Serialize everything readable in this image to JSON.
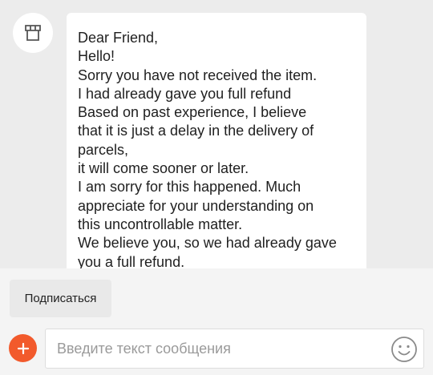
{
  "chat": {
    "avatar_icon": "store-icon",
    "message_lines": [
      "Dear Friend,",
      "Hello!",
      "Sorry you have not received the item.",
      "I had already gave you full refund",
      "Based on past experience, I believe",
      "that it is just a delay in the delivery of",
      "parcels,",
      "it will come sooner or later.",
      "I am sorry for this happened. Much",
      "appreciate for your understanding on",
      "this uncontrollable matter.",
      "We believe you, so we had already gave",
      "you a full refund."
    ]
  },
  "footer": {
    "subscribe_label": "Подписаться",
    "add_icon": "plus-icon",
    "input_placeholder": "Введите текст сообщения",
    "input_value": "",
    "emoji_icon": "smiley-icon"
  },
  "colors": {
    "accent": "#f25a2c",
    "chat_background": "#ececec",
    "bubble": "#ffffff"
  }
}
